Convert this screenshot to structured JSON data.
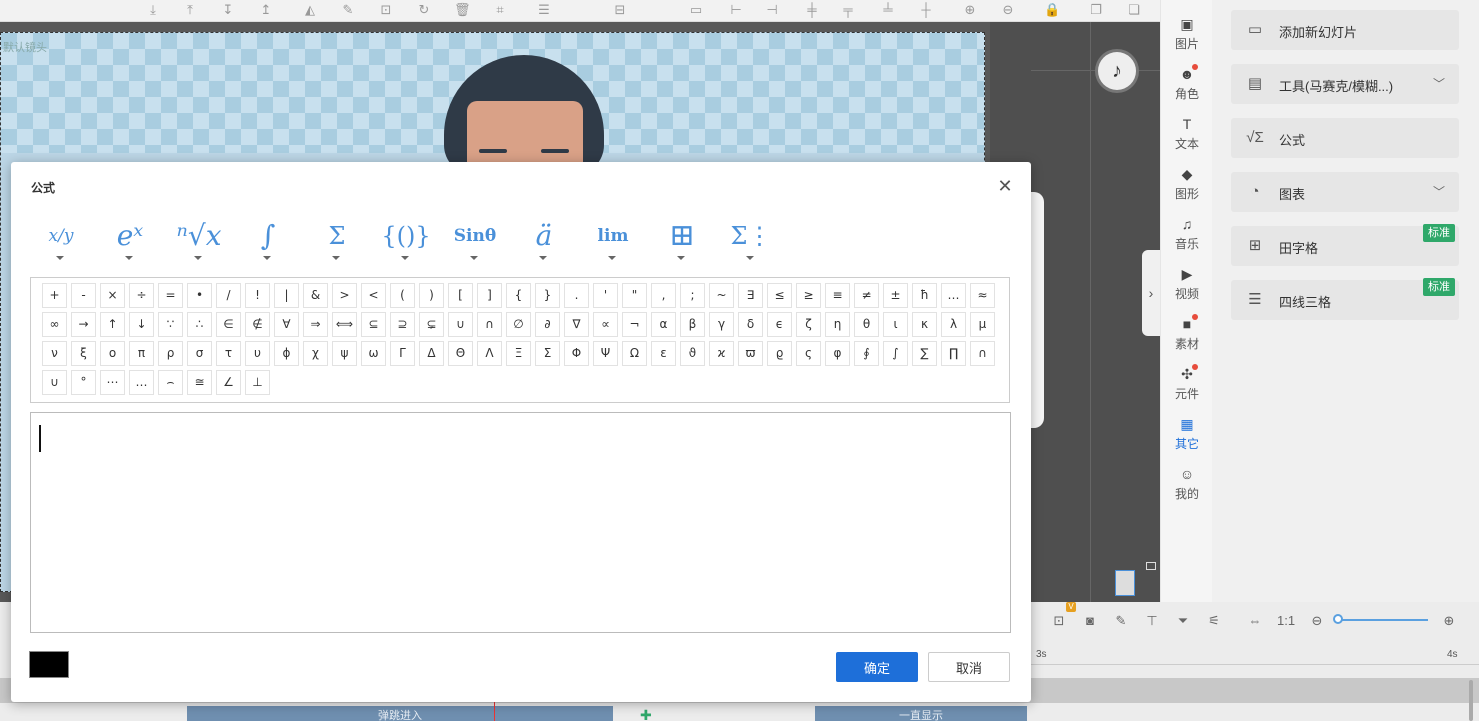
{
  "background": {
    "slide_label": "默认镜头",
    "track_labels": [
      "弹跳进入",
      "一直显示"
    ],
    "ruler_ticks": [
      "3s",
      "4s"
    ],
    "version_badge": "V"
  },
  "rail": {
    "items": [
      {
        "label": "图片",
        "icon": "image-icon",
        "glyph": "▣",
        "dot": false,
        "active": false
      },
      {
        "label": "角色",
        "icon": "person-icon",
        "glyph": "☻",
        "dot": true,
        "active": false
      },
      {
        "label": "文本",
        "icon": "text-icon",
        "glyph": "T",
        "dot": false,
        "active": false
      },
      {
        "label": "图形",
        "icon": "shape-icon",
        "glyph": "◆",
        "dot": false,
        "active": false
      },
      {
        "label": "音乐",
        "icon": "music-icon",
        "glyph": "♫",
        "dot": false,
        "active": false
      },
      {
        "label": "视频",
        "icon": "video-icon",
        "glyph": "▶",
        "dot": false,
        "active": false
      },
      {
        "label": "素材",
        "icon": "folder-icon",
        "glyph": "■",
        "dot": true,
        "active": false
      },
      {
        "label": "元件",
        "icon": "pinwheel-icon",
        "glyph": "✣",
        "dot": true,
        "active": false
      },
      {
        "label": "其它",
        "icon": "grid-icon",
        "glyph": "▦",
        "dot": false,
        "active": true
      },
      {
        "label": "我的",
        "icon": "user-icon",
        "glyph": "☺",
        "dot": false,
        "active": false
      }
    ]
  },
  "panel": {
    "cards": [
      {
        "label": "添加新幻灯片",
        "icon": "slideshow-icon",
        "glyph": "▭",
        "chevron": false,
        "badge": ""
      },
      {
        "label": "工具(马赛克/模糊...)",
        "icon": "toolbox-icon",
        "glyph": "▤",
        "chevron": true,
        "badge": ""
      },
      {
        "label": "公式",
        "icon": "formula-icon",
        "glyph": "√Σ",
        "chevron": false,
        "badge": ""
      },
      {
        "label": "图表",
        "icon": "pie-chart-icon",
        "glyph": "◔",
        "chevron": true,
        "badge": ""
      },
      {
        "label": "田字格",
        "icon": "tian-grid-icon",
        "glyph": "⊞",
        "chevron": false,
        "badge": "标准"
      },
      {
        "label": "四线三格",
        "icon": "four-line-icon",
        "glyph": "☰",
        "chevron": false,
        "badge": "标准"
      }
    ]
  },
  "dialog": {
    "title": "公式",
    "close_icon": "close-icon",
    "ok_label": "确定",
    "cancel_label": "取消",
    "editor_value": "",
    "text_color": "#000000",
    "categories": [
      {
        "name": "fraction",
        "glyph": "x/y"
      },
      {
        "name": "superscript",
        "glyph": "eˣ"
      },
      {
        "name": "radical",
        "glyph": "ⁿ√x"
      },
      {
        "name": "integral",
        "glyph": "∫"
      },
      {
        "name": "large-operator",
        "glyph": "Σ"
      },
      {
        "name": "bracket",
        "glyph": "{()}"
      },
      {
        "name": "function",
        "glyph": "Sinθ"
      },
      {
        "name": "accent",
        "glyph": "ä"
      },
      {
        "name": "limit",
        "glyph": "lim"
      },
      {
        "name": "matrix",
        "glyph": "⊞"
      },
      {
        "name": "operator",
        "glyph": "Σ⋮"
      }
    ],
    "symbols": [
      [
        "+",
        "-",
        "×",
        "÷",
        "=",
        "•",
        "/",
        "!",
        "|",
        "&",
        ">",
        "<",
        "(",
        ")",
        "[",
        "]",
        "{",
        "}",
        ".",
        "'",
        "\"",
        ",",
        ";",
        "~",
        "∃",
        "≤",
        "≥",
        "≡",
        "≠",
        "±",
        "ħ",
        "…",
        "≈"
      ],
      [
        "∞",
        "→",
        "↑",
        "↓",
        "∵",
        "∴",
        "∈",
        "∉",
        "∀",
        "⇒",
        "⟺",
        "⊆",
        "⊇",
        "⊊",
        "∪",
        "∩",
        "∅",
        "∂",
        "∇",
        "∝",
        "¬",
        "α",
        "β",
        "γ",
        "δ",
        "ϵ",
        "ζ",
        "η",
        "θ",
        "ι",
        "κ",
        "λ",
        "μ"
      ],
      [
        "ν",
        "ξ",
        "ο",
        "π",
        "ρ",
        "σ",
        "τ",
        "υ",
        "ϕ",
        "χ",
        "ψ",
        "ω",
        "Γ",
        "Δ",
        "Θ",
        "Λ",
        "Ξ",
        "Σ",
        "Φ",
        "Ψ",
        "Ω",
        "ε",
        "ϑ",
        "ϰ",
        "ϖ",
        "ϱ",
        "ς",
        "φ",
        "∮",
        "∫",
        "∑",
        "∏",
        "∩"
      ],
      [
        "∪",
        "°",
        "⋯",
        "…",
        "⌢",
        "≅",
        "∠",
        "⊥"
      ]
    ]
  }
}
